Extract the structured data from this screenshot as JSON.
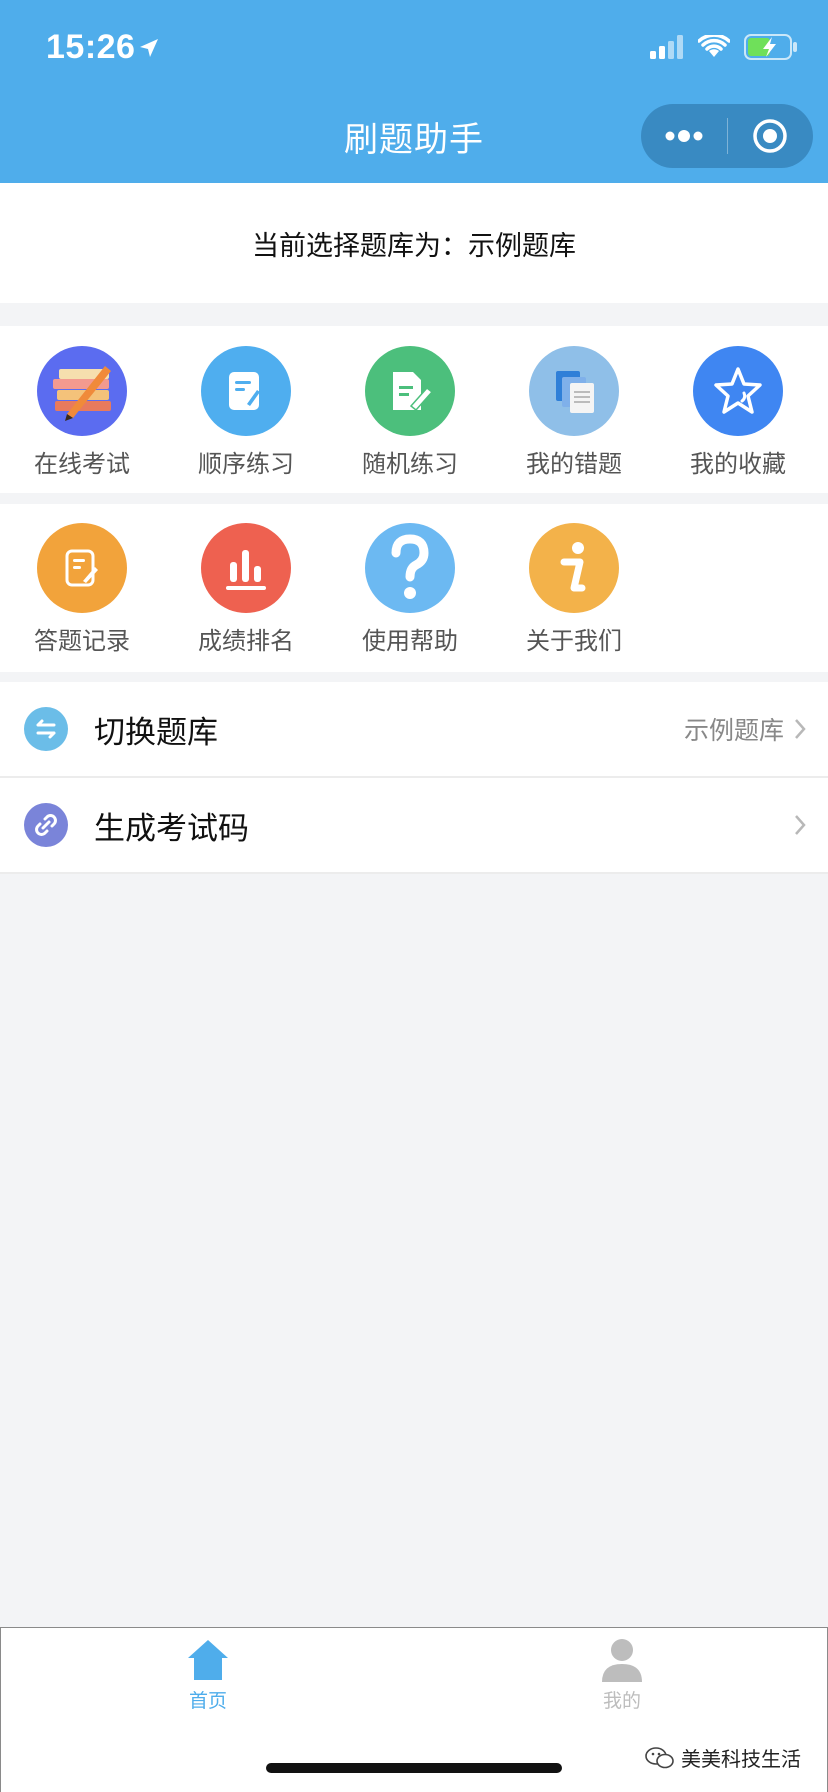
{
  "status_bar": {
    "time": "15:26"
  },
  "nav": {
    "title": "刷题助手"
  },
  "banner": {
    "text": "当前选择题库为：示例题库"
  },
  "grid": {
    "row1": [
      {
        "label": "在线考试",
        "icon": "exam-books-icon",
        "color": "#5b6cf0"
      },
      {
        "label": "顺序练习",
        "icon": "edit-note-icon",
        "color": "#4faeef"
      },
      {
        "label": "随机练习",
        "icon": "random-doc-icon",
        "color": "#4cbf7c"
      },
      {
        "label": "我的错题",
        "icon": "error-docs-icon",
        "color": "#8fbfe8"
      },
      {
        "label": "我的收藏",
        "icon": "star-icon",
        "color": "#3f86f2"
      }
    ],
    "row2": [
      {
        "label": "答题记录",
        "icon": "record-icon",
        "color": "#f2a33b"
      },
      {
        "label": "成绩排名",
        "icon": "bar-chart-icon",
        "color": "#ee6150"
      },
      {
        "label": "使用帮助",
        "icon": "help-icon",
        "color": "#6cb9f2"
      },
      {
        "label": "关于我们",
        "icon": "info-icon",
        "color": "#f3b24a"
      }
    ]
  },
  "list": {
    "switch_bank": {
      "title": "切换题库",
      "value": "示例题库",
      "icon": "switch-icon",
      "color": "#6bbde8"
    },
    "exam_code": {
      "title": "生成考试码",
      "icon": "link-icon",
      "color": "#7a84d9"
    }
  },
  "tabbar": {
    "home_label": "首页",
    "mine_label": "我的",
    "active_color": "#4fadeb",
    "inactive_color": "#bdbdbd"
  },
  "watermark": {
    "text": "美美科技生活"
  }
}
